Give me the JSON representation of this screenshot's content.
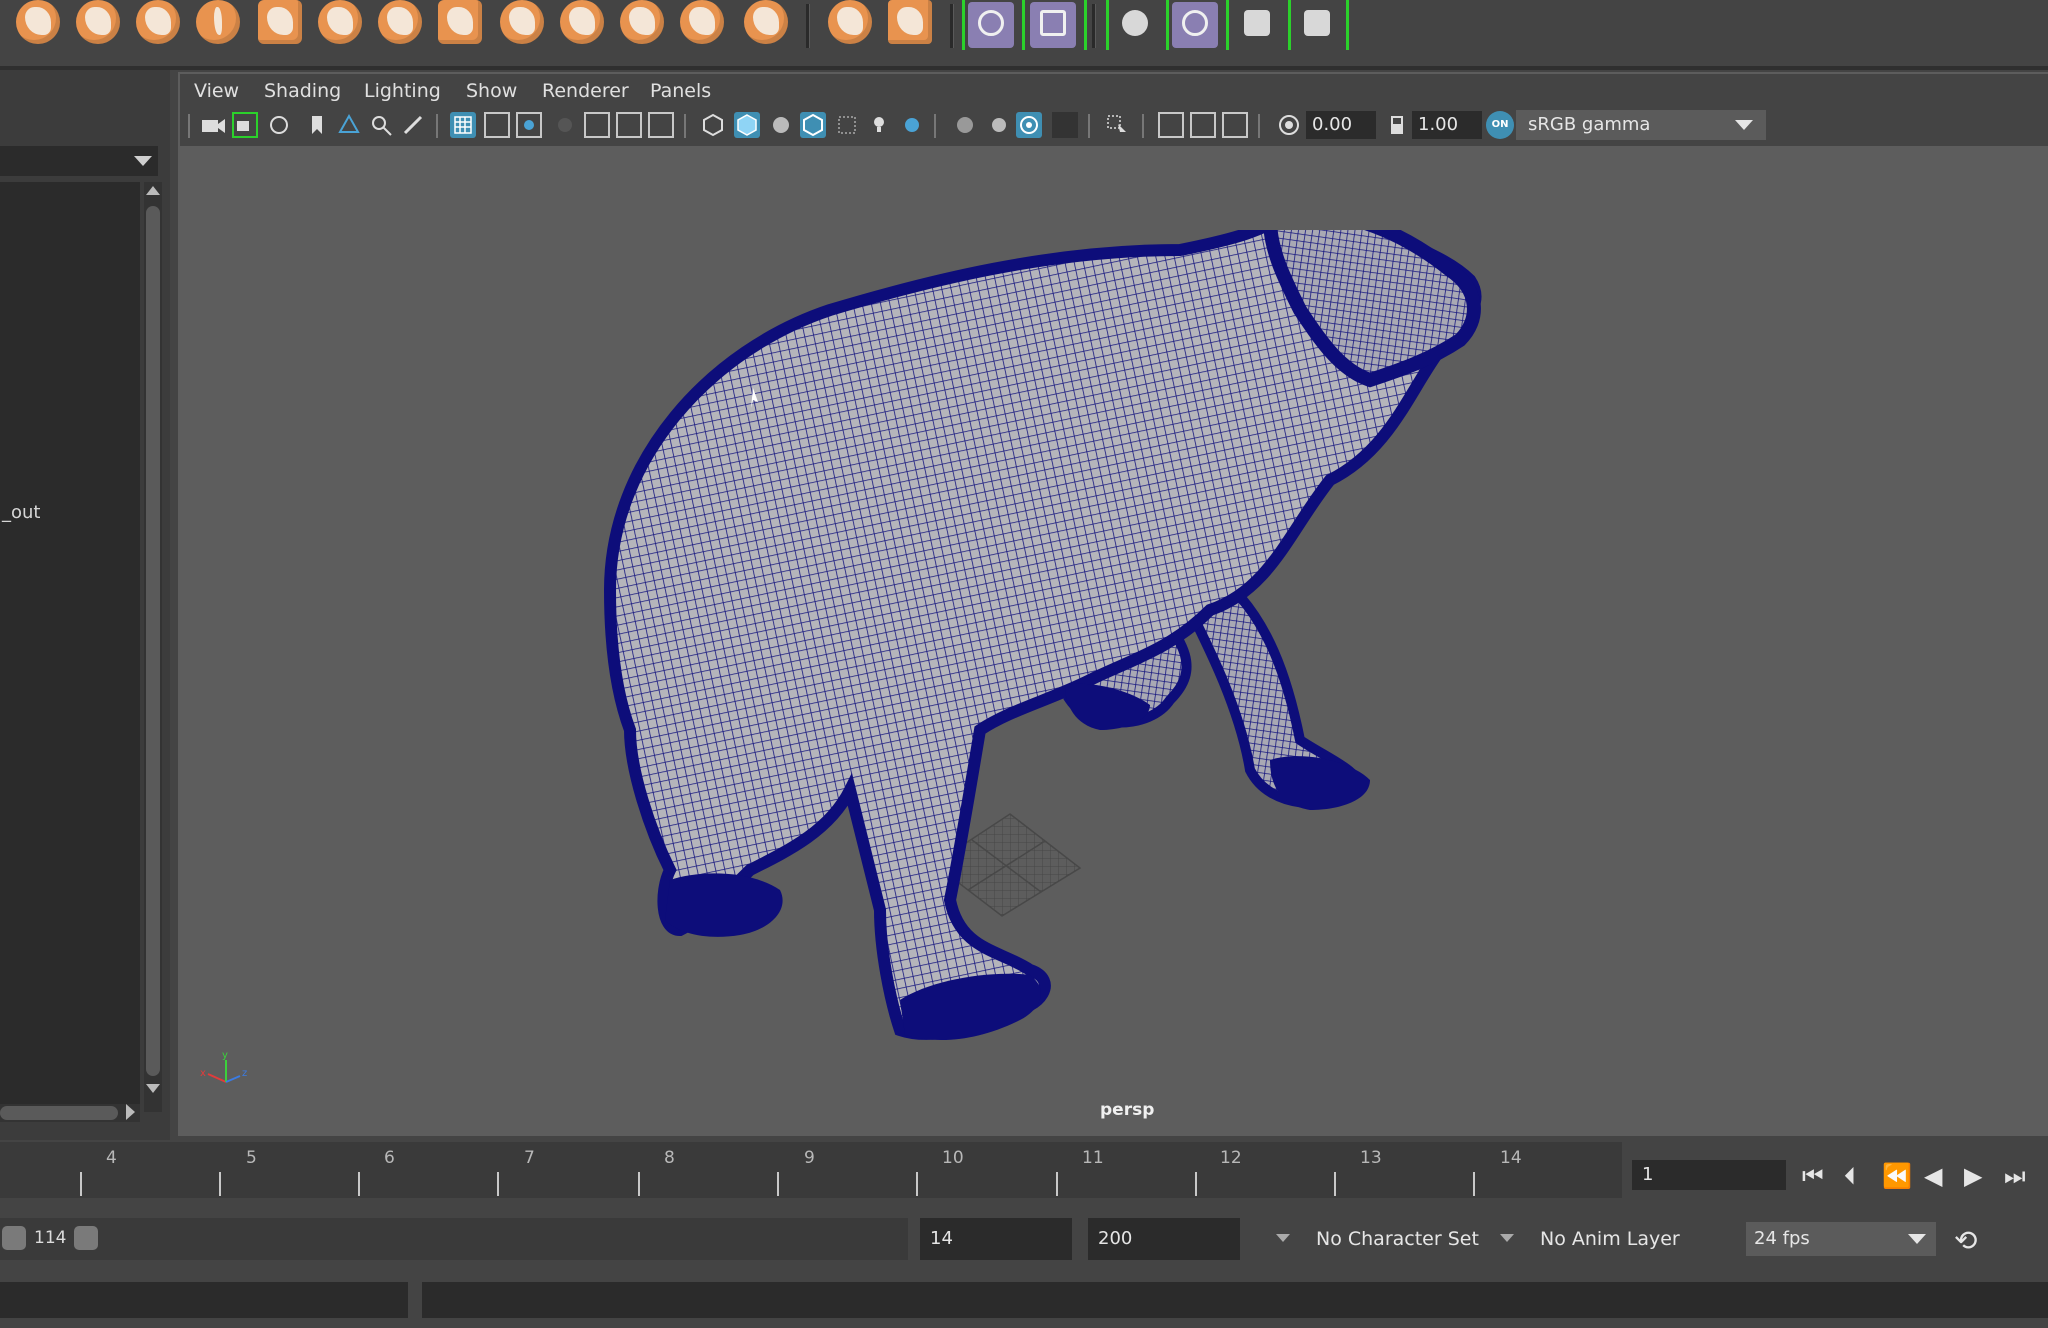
{
  "shelf": {
    "icons": [
      "sphere-icon",
      "torus-icon",
      "smooth-icon",
      "insert-loop-icon",
      "extrude-icon",
      "bevel-icon",
      "bridge-icon",
      "append-icon",
      "split-icon",
      "cut-icon",
      "target-weld-icon",
      "sculpt-icon",
      "snowflake-icon",
      "uv-icon",
      "uv-editor-icon",
      "skeleton-icon",
      "deformer-a-icon",
      "deformer-b-icon",
      "lattice-icon",
      "cluster-icon"
    ]
  },
  "outliner": {
    "visible_item": "_out"
  },
  "viewport": {
    "menus": [
      "View",
      "Shading",
      "Lighting",
      "Show",
      "Renderer",
      "Panels"
    ],
    "exposure": "0.00",
    "gamma": "1.00",
    "color_management_badge": "ON",
    "color_space": "sRGB gamma",
    "camera": "persp",
    "axis_labels": {
      "x": "x",
      "y": "y",
      "z": "z"
    },
    "mesh_color": "#0d0d7a",
    "background_color": "#5d5d5d"
  },
  "timeline": {
    "ticks": [
      "4",
      "5",
      "6",
      "7",
      "8",
      "9",
      "10",
      "11",
      "12",
      "13",
      "14"
    ],
    "current_frame": "1"
  },
  "range": {
    "range_value": "114",
    "start_frame": "14",
    "end_frame": "200",
    "character_set": "No Character Set",
    "anim_layer": "No Anim Layer",
    "fps": "24 fps"
  }
}
